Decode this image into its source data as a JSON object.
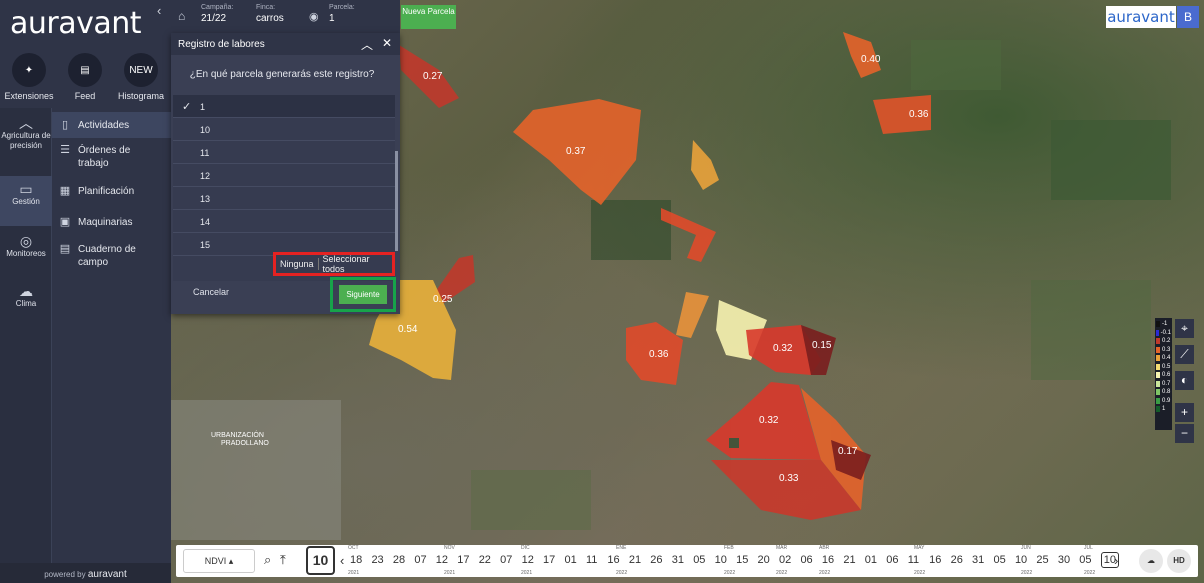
{
  "sidebar": {
    "logo": "auravant",
    "top_items": [
      {
        "label": "Extensiones",
        "icon": "puzzle-icon"
      },
      {
        "label": "Feed",
        "icon": "chat-icon"
      },
      {
        "label": "Histograma",
        "icon_text": "NEW"
      }
    ],
    "rail": [
      {
        "label": "Agricultura de precisión",
        "icon": "chart-icon"
      },
      {
        "label": "Gestión",
        "icon": "clipboard-icon",
        "active": true
      },
      {
        "label": "Monitoreos",
        "icon": "pin-icon"
      },
      {
        "label": "Clima",
        "icon": "cloud-icon"
      }
    ],
    "menu": [
      {
        "label": "Actividades",
        "active": true
      },
      {
        "label": "Órdenes de trabajo"
      },
      {
        "label": "Planificación"
      },
      {
        "label": "Maquinarias"
      },
      {
        "label": "Cuaderno de campo"
      }
    ],
    "powered": "powered by",
    "powered_brand": "auravant"
  },
  "topbar": {
    "campana_label": "Campaña:",
    "campana_value": "21/22",
    "finca_label": "Finca:",
    "finca_value": "carros",
    "parcela_label": "Parcela:",
    "parcela_value": "1",
    "nueva_parcela": "Nueva Parcela"
  },
  "panel": {
    "title": "Registro de labores",
    "question": "¿En qué parcela generarás este registro?",
    "items": [
      "1",
      "10",
      "11",
      "12",
      "13",
      "14",
      "15"
    ],
    "selected": "1",
    "none_label": "Ninguna",
    "select_all_label": "Seleccionar todos",
    "cancel_label": "Cancelar",
    "next_label": "Siguiente"
  },
  "brand": {
    "name": "auravant",
    "avatar": "B"
  },
  "map": {
    "town_label": "URBANIZACIÓN PRADOLLANO",
    "field_values": [
      "0.27",
      "0.37",
      "0.40",
      "0.36",
      "0.25",
      "0.54",
      "0.36",
      "0.32",
      "0.15",
      "0.32",
      "0.17",
      "0.33"
    ]
  },
  "legend": {
    "items": [
      {
        "label": "-1",
        "color": "#111111"
      },
      {
        "label": "-0.1",
        "color": "#2b2bd6"
      },
      {
        "label": "0.2",
        "color": "#c0392b"
      },
      {
        "label": "0.3",
        "color": "#e4632a"
      },
      {
        "label": "0.4",
        "color": "#e9a23b"
      },
      {
        "label": "0.5",
        "color": "#f4dc72"
      },
      {
        "label": "0.6",
        "color": "#f7f3b0"
      },
      {
        "label": "0.7",
        "color": "#c9e59a"
      },
      {
        "label": "0.8",
        "color": "#7fc466"
      },
      {
        "label": "0.9",
        "color": "#3a9c45"
      },
      {
        "label": "1",
        "color": "#145c2a"
      }
    ]
  },
  "timeline": {
    "index": "NDVI",
    "calendar_day": "10",
    "days": [
      "18",
      "23",
      "28",
      "07",
      "12",
      "17",
      "22",
      "07",
      "12",
      "17",
      "01",
      "11",
      "16",
      "21",
      "26",
      "31",
      "05",
      "10",
      "15",
      "20",
      "02",
      "06",
      "16",
      "21",
      "01",
      "06",
      "11",
      "16",
      "26",
      "31",
      "05",
      "10",
      "25",
      "30",
      "05",
      "10"
    ],
    "months": [
      "OCT",
      "NOV",
      "DIC",
      "ENE",
      "FEB",
      "MAR",
      "ABR",
      "MAY",
      "JUN",
      "JUL"
    ],
    "years": [
      "2021",
      "2021",
      "2021",
      "2022",
      "2022",
      "2022",
      "2022",
      "2022",
      "2022",
      "2022"
    ],
    "hd_label": "HD"
  }
}
